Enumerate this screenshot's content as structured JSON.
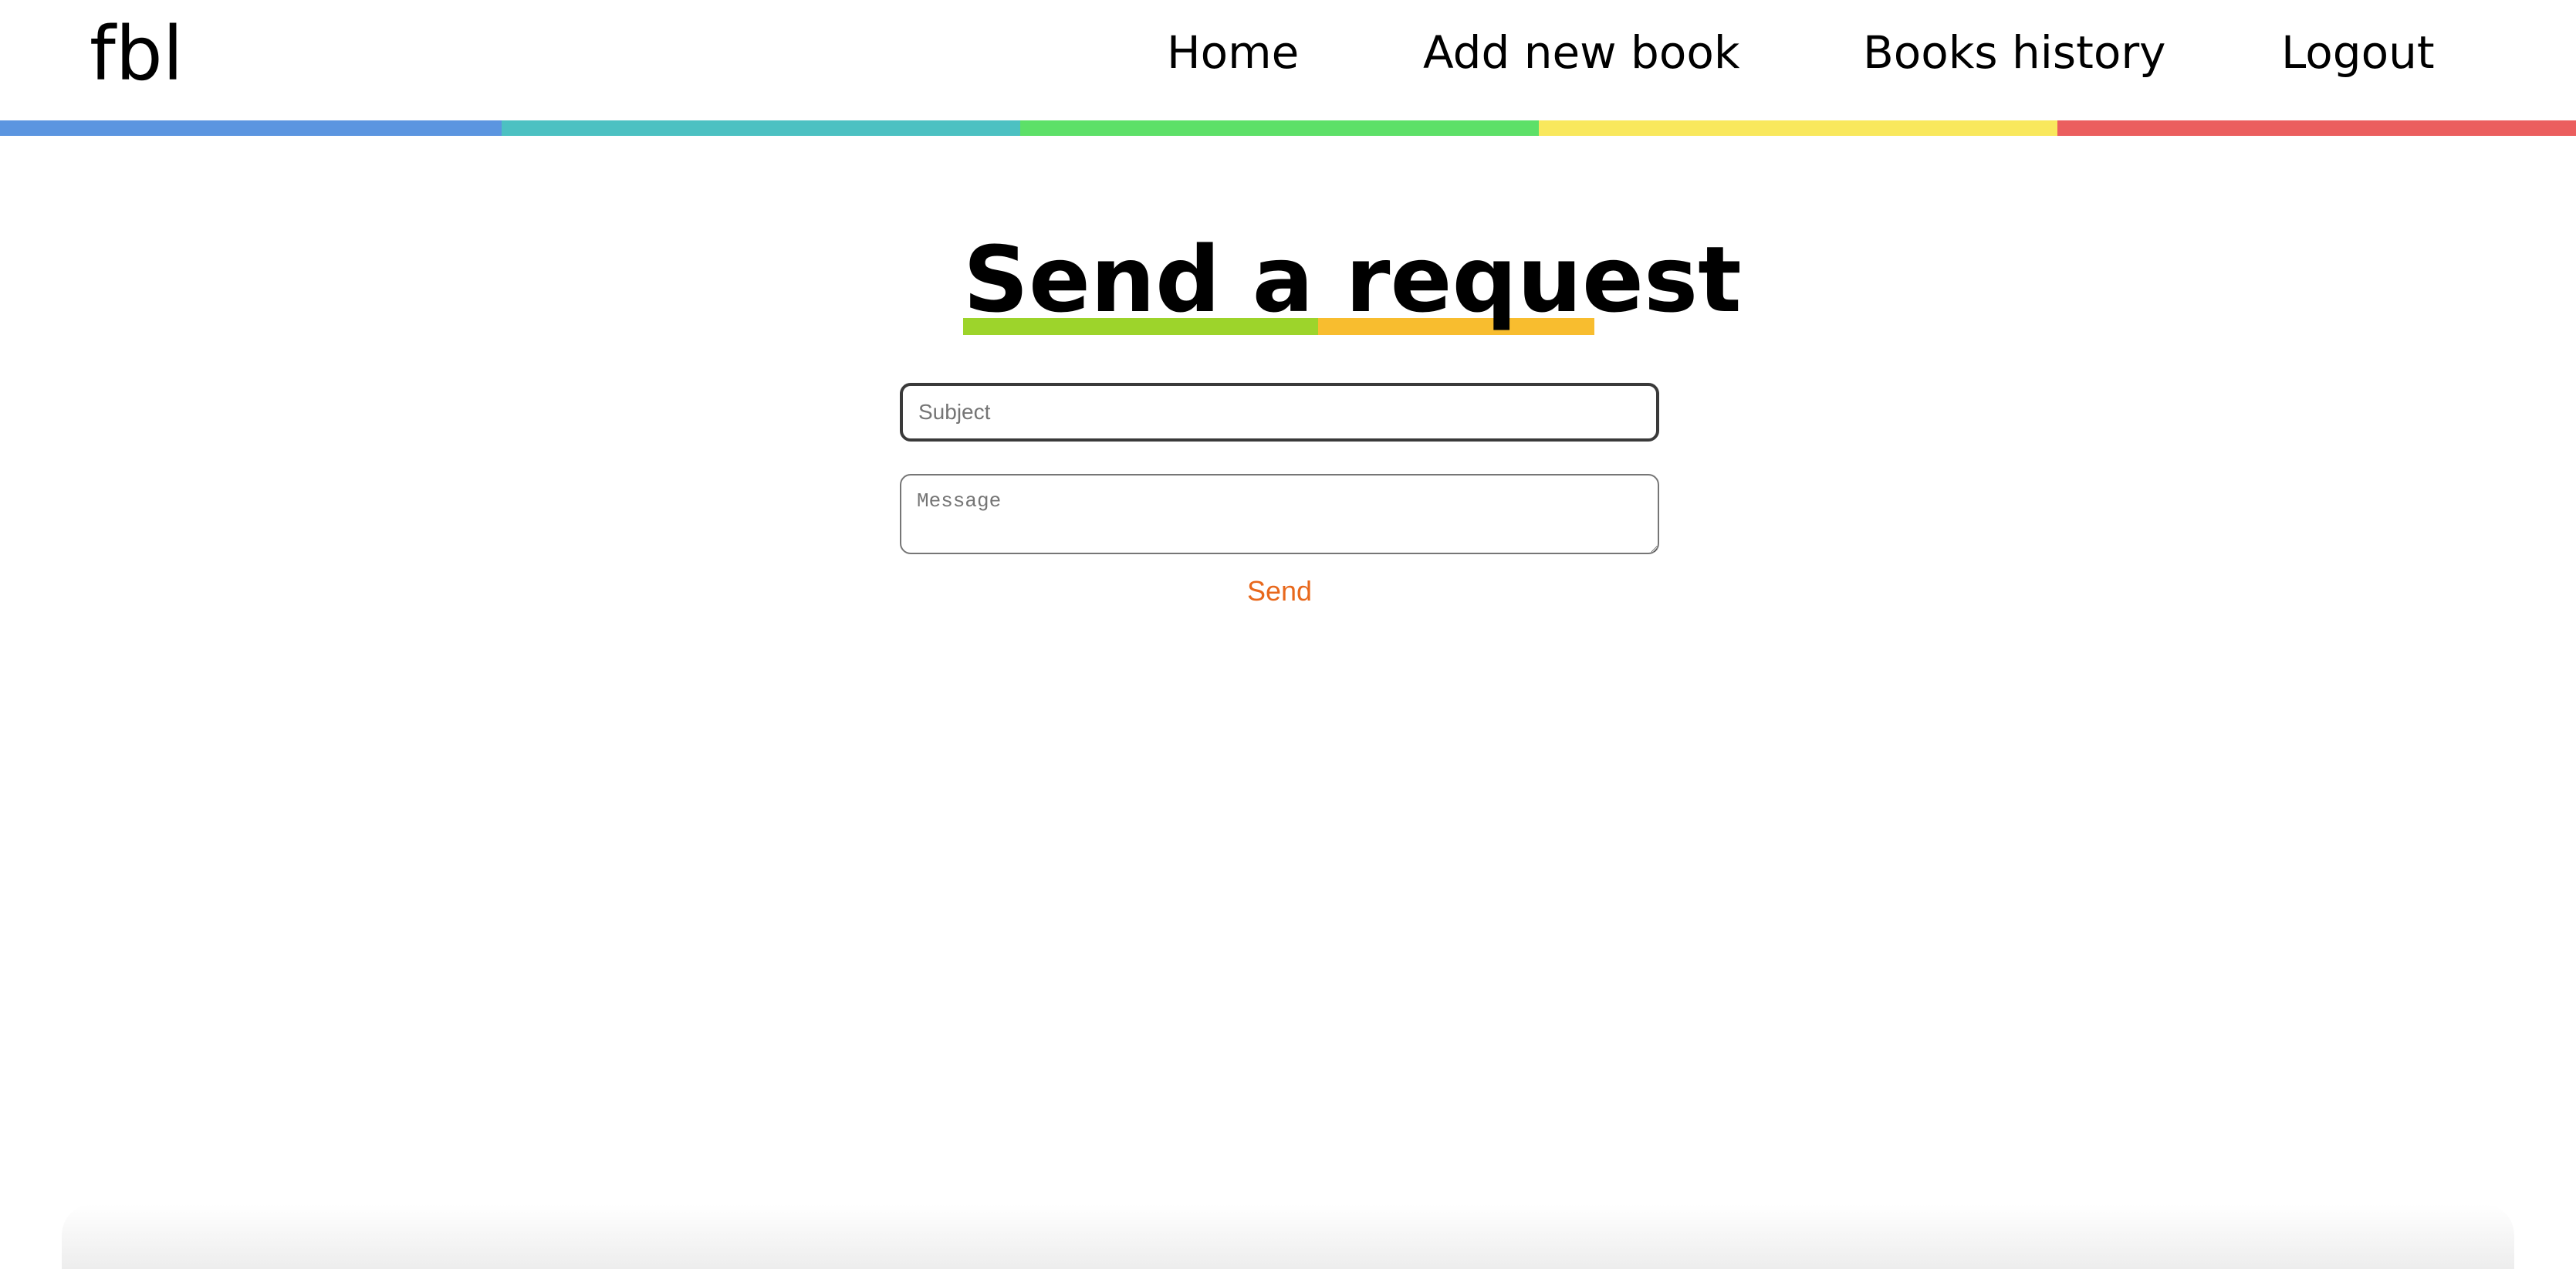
{
  "header": {
    "logo": "fbl",
    "nav": {
      "home": "Home",
      "add_book": "Add new book",
      "books_history": "Books history",
      "logout": "Logout"
    }
  },
  "strip_colors": [
    "#5b95e0",
    "#4cc1c2",
    "#5de068",
    "#f9e85d",
    "#eb5e5e"
  ],
  "main": {
    "title": "Send a request",
    "underline_colors": [
      "#9dd42b",
      "#f8bd2f"
    ],
    "subject_placeholder": "Subject",
    "subject_value": "",
    "message_placeholder": "Message",
    "message_value": "",
    "send_label": "Send",
    "send_color": "#e8681c"
  }
}
